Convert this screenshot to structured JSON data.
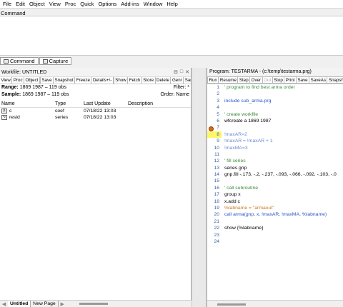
{
  "menu": [
    "File",
    "Edit",
    "Object",
    "View",
    "Proc",
    "Quick",
    "Options",
    "Add-ins",
    "Window",
    "Help"
  ],
  "command": {
    "label": "Command",
    "tabs": [
      "Command",
      "Capture"
    ]
  },
  "workfile": {
    "title": "Workfile: UNTITLED",
    "title_controls": [
      "⊟",
      "□",
      "✕"
    ],
    "toolbar": [
      "View",
      "Proc",
      "Object",
      "",
      "Save",
      "Snapshot",
      "Freeze",
      "Details+/-",
      "",
      "Show",
      "Fetch",
      "Store",
      "Delete",
      "Genr",
      "Samp"
    ],
    "range_label": "Range:",
    "range_value": "1869 1987  –   119 obs",
    "filter": "Filter: *",
    "sample_label": "Sample:",
    "sample_value": "1869 1987  –   119 obs",
    "order": "Order: Name",
    "columns": [
      "Name",
      "Type",
      "Last Update",
      "Description"
    ],
    "objects": [
      {
        "icon": "coef-icon",
        "name": "c",
        "type": "coef",
        "updated": "07/18/22  13:03",
        "description": ""
      },
      {
        "icon": "series-icon",
        "name": "resid",
        "type": "series",
        "updated": "07/18/22  13:03",
        "description": ""
      }
    ],
    "bottom_tabs": [
      "Untitled",
      "New Page"
    ]
  },
  "program": {
    "title": "Program: TESTARMA - (c:\\temp\\testarma.prg)",
    "toolbar": [
      "Run",
      "Resume",
      "Step",
      "Over",
      "Out",
      "Stop",
      "Print",
      "Save",
      "SaveAs",
      "Snapsh"
    ],
    "toolbar_disabled": [
      "Out"
    ],
    "breakpoint_line": 8,
    "current_line": 8,
    "lines": [
      {
        "n": "1",
        "t": "' program to find best arma order",
        "cls": "com"
      },
      {
        "n": "2",
        "t": "",
        "cls": ""
      },
      {
        "n": "3",
        "t": "include sub_arma.prg",
        "cls": "kw"
      },
      {
        "n": "4",
        "t": "",
        "cls": ""
      },
      {
        "n": "5",
        "t": "' create workfile",
        "cls": "com"
      },
      {
        "n": "6",
        "t": "wfcreate a 1869 1987",
        "cls": ""
      },
      {
        "n": "7",
        "t": "",
        "cls": ""
      },
      {
        "n": "8",
        "t": "!maxAR=2",
        "cls": "var"
      },
      {
        "n": "9",
        "t": "!maxAR = !maxAR + 1",
        "cls": "var"
      },
      {
        "n": "10",
        "t": "!maxMA=3",
        "cls": "var"
      },
      {
        "n": "11",
        "t": "",
        "cls": ""
      },
      {
        "n": "12",
        "t": "' fill series",
        "cls": "com"
      },
      {
        "n": "13",
        "t": "series gnp",
        "cls": ""
      },
      {
        "n": "14",
        "t": "gnp.fill -.173, -.2, -.237, -.093, -.066, -.092, -.103, -.0",
        "cls": ""
      },
      {
        "n": "15",
        "t": "",
        "cls": ""
      },
      {
        "n": "16",
        "t": "' call subroutine",
        "cls": "com"
      },
      {
        "n": "17",
        "t": "group x",
        "cls": ""
      },
      {
        "n": "18",
        "t": "x.add c",
        "cls": ""
      },
      {
        "n": "19",
        "t": "%labname = \"armaout\"",
        "cls": "str"
      },
      {
        "n": "20",
        "t": "call arma(gnp, x, !maxAR, !maxMA, %labname)",
        "cls": "kw"
      },
      {
        "n": "21",
        "t": "",
        "cls": ""
      },
      {
        "n": "22",
        "t": "show {%labname}",
        "cls": ""
      },
      {
        "n": "23",
        "t": "",
        "cls": ""
      },
      {
        "n": "24",
        "t": "",
        "cls": ""
      }
    ]
  }
}
